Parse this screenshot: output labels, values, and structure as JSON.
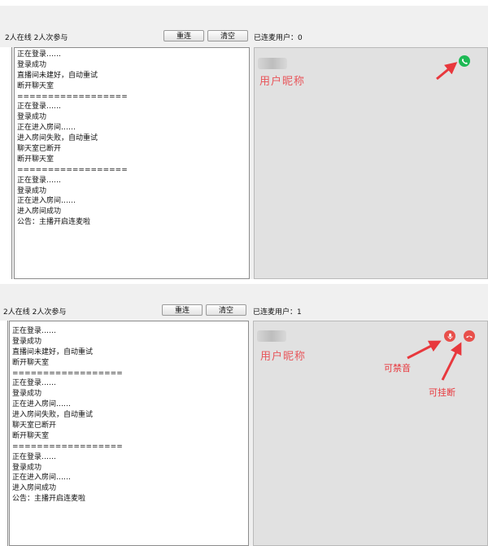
{
  "top": {
    "online_status": "2人在线 2人次参与",
    "reconnect_label": "重连",
    "clear_label": "清空",
    "connected_count": "已连麦用户：0",
    "log_lines": [
      "正在登录……",
      "登录成功",
      "直播间未建好，自动重试",
      "断开聊天室",
      "==================",
      "正在登录……",
      "登录成功",
      "正在进入房间……",
      "进入房间失败，自动重试",
      "聊天室已断开",
      "断开聊天室",
      "==================",
      "正在登录……",
      "登录成功",
      "正在进入房间……",
      "进入房间成功",
      "公告：主播开启连麦啦"
    ],
    "user_nickname": "用户昵称",
    "call_icon": "phone-icon",
    "call_color": "#1db954"
  },
  "bottom": {
    "online_status": "2人在线 2人次参与",
    "reconnect_label": "重连",
    "clear_label": "清空",
    "connected_count": "已连麦用户：1",
    "log_lines": [
      "正在登录……",
      "登录成功",
      "直播间未建好，自动重试",
      "断开聊天室",
      "==================",
      "正在登录……",
      "登录成功",
      "正在进入房间……",
      "进入房间失败，自动重试",
      "聊天室已断开",
      "断开聊天室",
      "==================",
      "正在登录……",
      "登录成功",
      "正在进入房间……",
      "进入房间成功",
      "公告：主播开启连麦啦"
    ],
    "user_nickname": "用户昵称",
    "mute_icon": "microphone-icon",
    "hangup_icon": "hang-up-icon",
    "action_color": "#e8504b",
    "mute_note": "可禁音",
    "hangup_note": "可挂断"
  },
  "annotation_color": "#e8383d"
}
